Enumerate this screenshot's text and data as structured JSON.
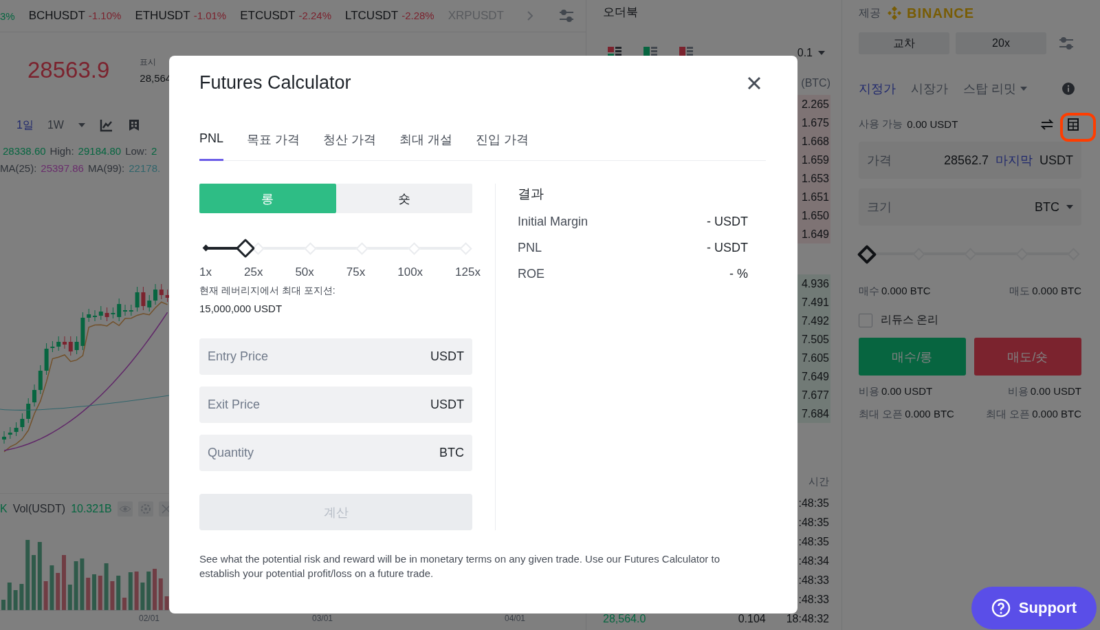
{
  "ticker": [
    {
      "change": "3%",
      "kind": "up"
    },
    {
      "symbol": "BCHUSDT",
      "change": "-1.10%",
      "kind": "down"
    },
    {
      "symbol": "ETHUSDT",
      "change": "-1.01%",
      "kind": "down"
    },
    {
      "symbol": "ETCUSDT",
      "change": "-2.24%",
      "kind": "down"
    },
    {
      "symbol": "LTCUSDT",
      "change": "-2.28%",
      "kind": "down"
    },
    {
      "symbol": "XRPUSDT"
    }
  ],
  "chart_header": {
    "last_price": "28563.9",
    "mark_label": "표시",
    "mark_price": "28,564"
  },
  "intervals": [
    {
      "label": "1일",
      "selected": true
    },
    {
      "label": "1W",
      "selected": false
    }
  ],
  "ohlc_line": [
    {
      "value": "28338.60"
    },
    {
      "label": "High:",
      "value": "29184.80"
    },
    {
      "label": "Low:",
      "value": "2"
    }
  ],
  "ma_line": [
    {
      "label": "MA(25):",
      "value": "25397.86",
      "kind": "ma25"
    },
    {
      "label": "MA(99):",
      "value": "22178.",
      "kind": "ma99"
    }
  ],
  "volume": {
    "cut_label": "K",
    "label": "Vol(USDT)",
    "value": "10.321B"
  },
  "dates": [
    "02/01",
    "03/01",
    "04/01"
  ],
  "orderbook": {
    "title": "오더북",
    "step": "0.1",
    "column_header": "(BTC)",
    "asks": [
      "2.265",
      "1.675",
      "1.668",
      "1.659",
      "1.653",
      "1.651",
      "1.650",
      "1.649"
    ],
    "bids": [
      "4.936",
      "7.491",
      "7.492",
      "7.505",
      "7.605",
      "7.649",
      "7.677",
      "7.684"
    ],
    "trades_header": "시간",
    "trades": [
      {
        "time": ":48:35"
      },
      {
        "time": ":48:35"
      },
      {
        "time": ":48:35"
      },
      {
        "time": ":48:34"
      },
      {
        "time": ":48:33"
      },
      {
        "time": ":48:33"
      },
      {
        "price": "28,564.0",
        "amount": "0.104",
        "time": "18:48:32"
      }
    ]
  },
  "order_panel": {
    "provider_label": "제공",
    "brand": "BINANCE",
    "mode_buttons": [
      "교차",
      "20x"
    ],
    "order_types": [
      {
        "label": "지정가",
        "selected": true,
        "has_menu": false
      },
      {
        "label": "시장가",
        "selected": false,
        "has_menu": false
      },
      {
        "label": "스탑 리밋",
        "selected": false,
        "has_menu": true
      }
    ],
    "available_label": "사용 가능",
    "available_value": "0.00 USDT",
    "price_field": {
      "label": "가격",
      "value": "28562.7",
      "tag": "마지막",
      "unit": "USDT"
    },
    "size_field": {
      "label": "크기",
      "unit": "BTC"
    },
    "size_slider": {
      "level": 0
    },
    "buy_amount": {
      "label": "매수",
      "value": "0.000 BTC"
    },
    "sell_amount": {
      "label": "매도",
      "value": "0.000 BTC"
    },
    "reduce_only": {
      "label": "리듀스 온리",
      "checked": false
    },
    "buy_button": "매수/롱",
    "sell_button": "매도/숏",
    "costs": [
      {
        "label": "비용",
        "value": "0.00 USDT"
      },
      {
        "label": "비용",
        "value": "0.00 USDT"
      }
    ],
    "max_open": [
      {
        "label": "최대 오픈",
        "value": "0.000 BTC"
      },
      {
        "label": "최대 오픈",
        "value": "0.000 BTC"
      }
    ]
  },
  "modal": {
    "title": "Futures Calculator",
    "tabs": [
      {
        "label": "PNL",
        "selected": true
      },
      {
        "label": "목표 가격",
        "selected": false
      },
      {
        "label": "청산 가격",
        "selected": false
      },
      {
        "label": "최대 개설",
        "selected": false
      },
      {
        "label": "진입 가격",
        "selected": false
      }
    ],
    "sides": [
      {
        "label": "롱",
        "kind": "long",
        "selected": true
      },
      {
        "label": "숏",
        "kind": "short",
        "selected": false
      }
    ],
    "leverage": {
      "level": 0.15,
      "marks": [
        "1x",
        "25x",
        "50x",
        "75x",
        "100x",
        "125x"
      ]
    },
    "max_position_label": "현재 레버리지에서 최대 포지션:",
    "max_position_value": "15,000,000 USDT",
    "fields": [
      {
        "placeholder": "Entry Price",
        "unit": "USDT"
      },
      {
        "placeholder": "Exit Price",
        "unit": "USDT"
      },
      {
        "placeholder": "Quantity",
        "unit": "BTC"
      }
    ],
    "calculate": {
      "label": "계산",
      "disabled": true
    },
    "result_title": "결과",
    "results": [
      {
        "label": "Initial Margin",
        "value": "- USDT"
      },
      {
        "label": "PNL",
        "value": "- USDT"
      },
      {
        "label": "ROE",
        "value": "- %"
      }
    ],
    "description": "See what the potential risk and reward will be in monetary terms on any given trade. Use our Futures Calculator to establish your potential profit/loss on a future trade."
  },
  "support": "Support"
}
